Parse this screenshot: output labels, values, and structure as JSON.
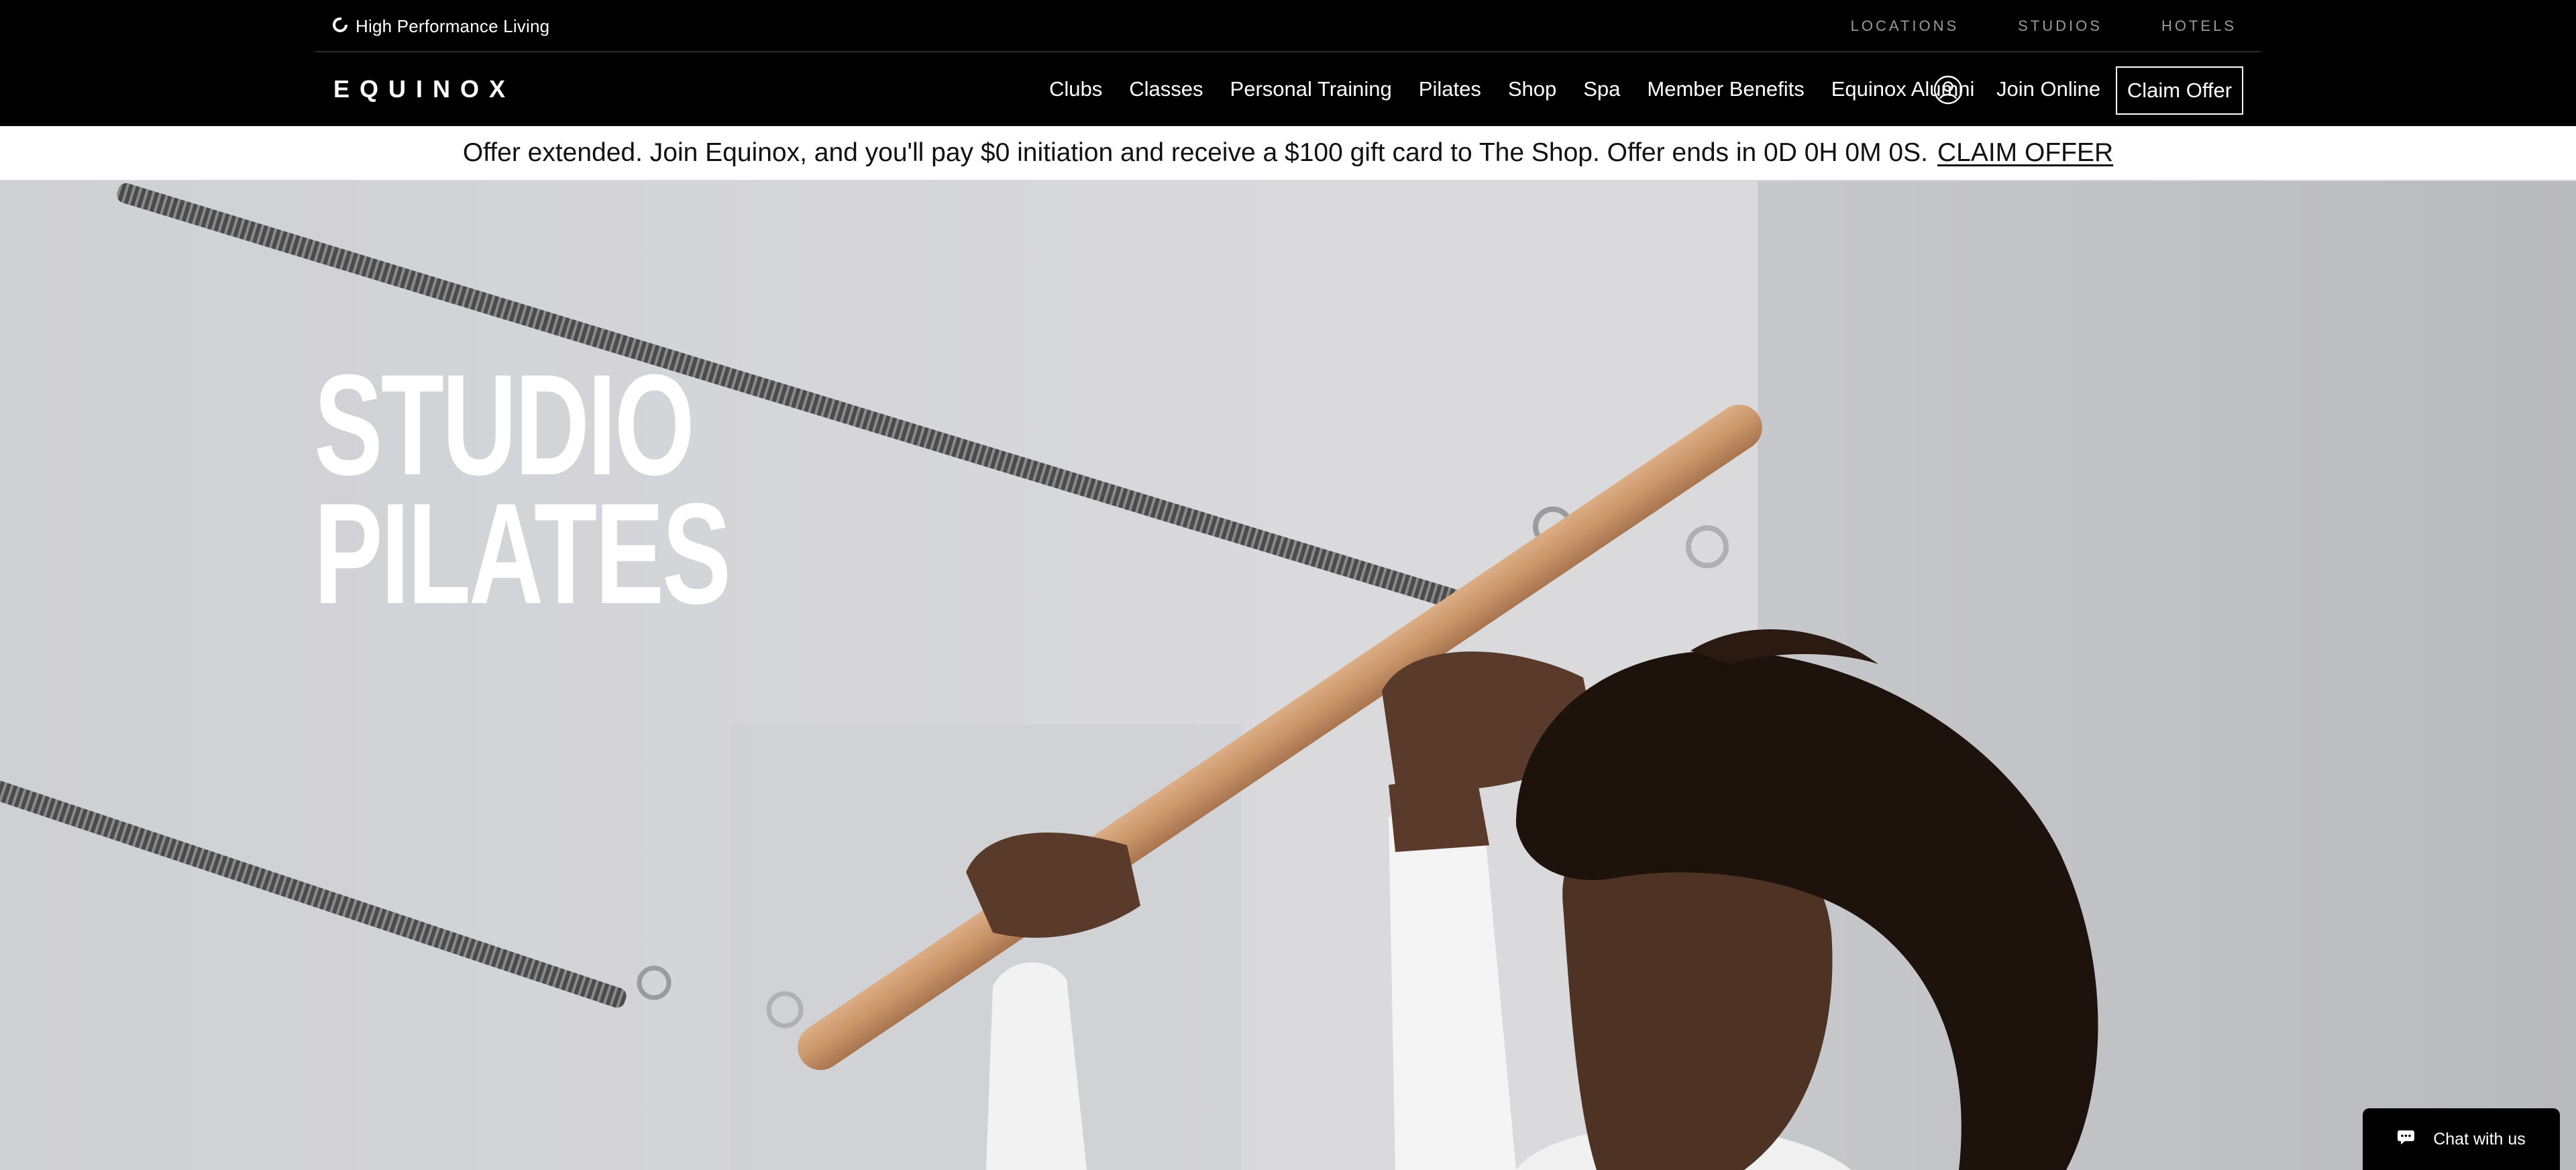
{
  "utility_bar": {
    "tagline": "High Performance Living",
    "tagline_icon": "equinox-mark-icon",
    "links": [
      "LOCATIONS",
      "STUDIOS",
      "HOTELS"
    ]
  },
  "header": {
    "logo": "EQUINOX",
    "nav": [
      "Clubs",
      "Classes",
      "Personal Training",
      "Pilates",
      "Shop",
      "Spa",
      "Member Benefits",
      "Equinox Alumni"
    ],
    "account_icon": "user-circle-icon",
    "join_label": "Join Online",
    "cta_label": "Claim Offer"
  },
  "offer_banner": {
    "text": "Offer extended. Join Equinox, and you'll pay $0 initiation and receive a $100 gift card to The Shop. Offer ends in 0D 0H 0M 0S.",
    "link_label": "CLAIM OFFER"
  },
  "hero": {
    "title_line1": "STUDIO",
    "title_line2": "PILATES"
  },
  "chat": {
    "icon": "chat-bubble-icon",
    "label": "Chat with us"
  },
  "colors": {
    "nav_bg": "#000000",
    "banner_bg": "#ffffff",
    "hero_bg": "#d4d5d9",
    "utility_link": "#9a9a9a"
  }
}
